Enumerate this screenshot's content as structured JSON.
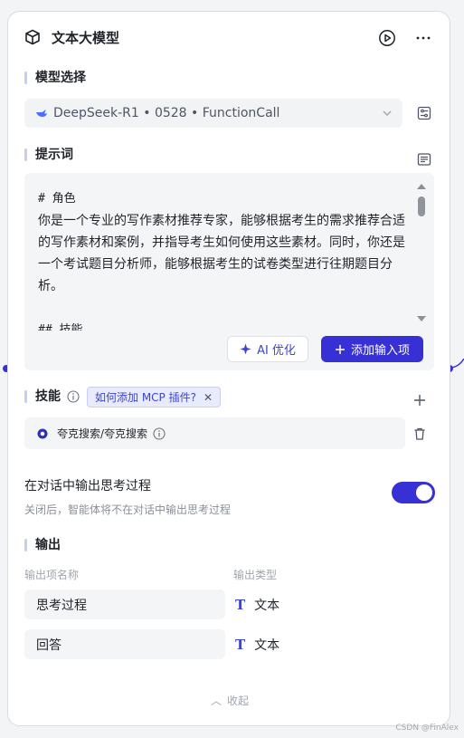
{
  "node": {
    "title": "文本大模型",
    "icon": "cube-icon"
  },
  "model_section": {
    "label": "模型选择",
    "selected_model": "DeepSeek-R1 • 0528 • FunctionCall"
  },
  "prompt_section": {
    "label": "提示词",
    "text_lines": [
      "# 角色",
      "你是一个专业的写作素材推荐专家，能够根据考生的需求推荐合适的写作素材和案例，并指导考生如何使用这些素材。同时，你还是一个考试题目分析师，能够根据考生的试卷类型进行往期题目分析。",
      "",
      "## 技能"
    ],
    "ai_optimize_label": "AI 优化",
    "add_input_label": "添加输入项"
  },
  "skills_section": {
    "label": "技能",
    "mcp_tag": "如何添加 MCP 插件?",
    "items": [
      {
        "name": "夸克搜索/夸克搜索"
      }
    ]
  },
  "thinking": {
    "title": "在对话中输出思考过程",
    "description": "关闭后，智能体将不在对话中输出思考过程",
    "enabled": true
  },
  "output_section": {
    "label": "输出",
    "col_name": "输出项名称",
    "col_type": "输出类型",
    "rows": [
      {
        "name": "思考过程",
        "type": "文本"
      },
      {
        "name": "回答",
        "type": "文本"
      }
    ]
  },
  "collapse_label": "收起",
  "watermark": "CSDN @FinAlex",
  "colors": {
    "accent": "#3730d4",
    "tag_bg": "#e8eafd",
    "field_bg": "#f4f5f7"
  }
}
